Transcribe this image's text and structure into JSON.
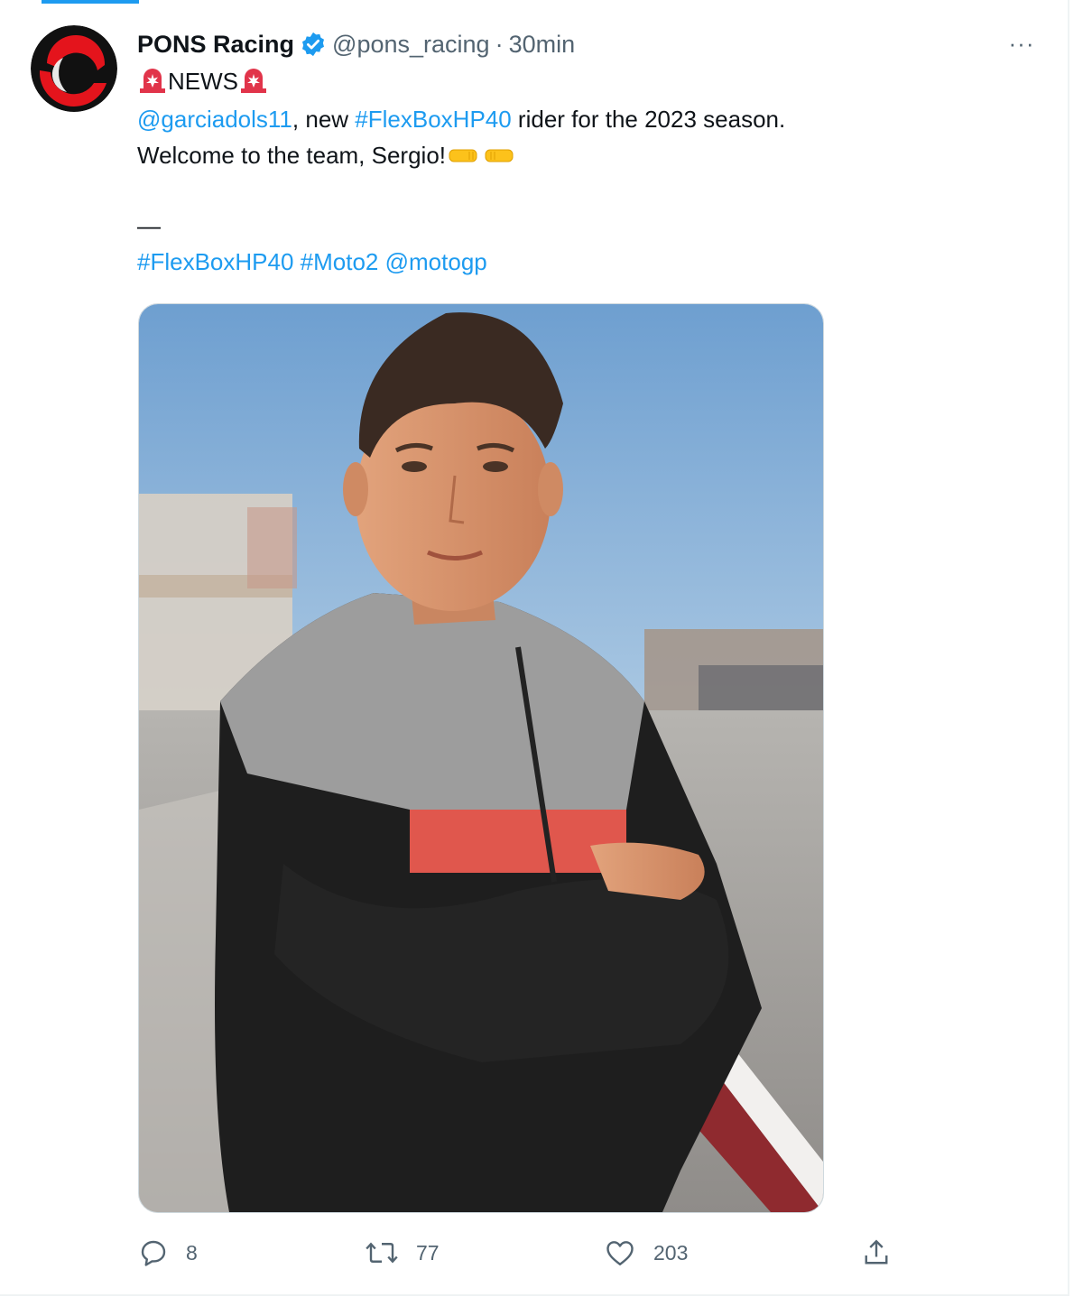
{
  "tweet": {
    "author": {
      "name": "PONS Racing",
      "handle": "@pons_racing",
      "separator": "·",
      "time": "30min",
      "verified": true,
      "avatar_icon": "pons-racing-logo"
    },
    "more_label": "···",
    "lines": {
      "line1_text": "NEWS",
      "line2_mention": "@garciadols11",
      "line2_mid": ", new ",
      "line2_hashtag": "#FlexBoxHP40",
      "line2_tail": " rider for the 2023 season.",
      "line3_text": "Welcome to the team, Sergio!",
      "line4_dash": "—",
      "line5_hashtag1": "#FlexBoxHP40",
      "line5_hashtag2": "#Moto2",
      "line5_mention": "@motogp"
    },
    "emojis": [
      "rotating-light-icon",
      "fist-bump-icon"
    ],
    "media": {
      "icon": "rider-photo"
    },
    "actions": {
      "replies": "8",
      "retweets": "77",
      "likes": "203"
    }
  },
  "colors": {
    "link": "#1d9bf0",
    "muted": "#536471",
    "text": "#0f1419",
    "verified": "#1d9bf0"
  }
}
